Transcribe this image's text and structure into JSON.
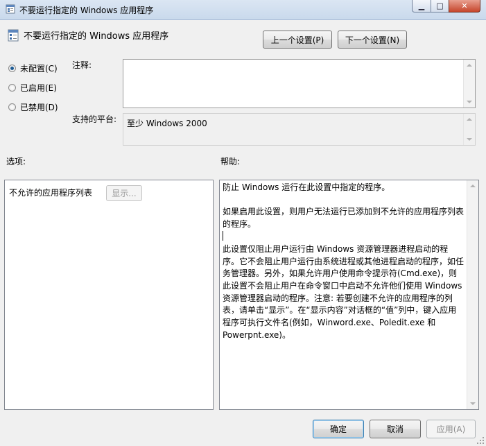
{
  "window": {
    "title": "不要运行指定的 Windows 应用程序",
    "min_glyph": "▁",
    "max_glyph": "□",
    "close_glyph": "✕"
  },
  "header": {
    "title": "不要运行指定的 Windows 应用程序",
    "prev_label": "上一个设置(P)",
    "next_label": "下一个设置(N)"
  },
  "state": {
    "options": [
      {
        "label": "未配置(C)",
        "selected": true
      },
      {
        "label": "已启用(E)",
        "selected": false
      },
      {
        "label": "已禁用(D)",
        "selected": false
      }
    ]
  },
  "comment": {
    "label": "注释:",
    "value": ""
  },
  "platform": {
    "label": "支持的平台:",
    "value": "至少 Windows 2000"
  },
  "options_panel": {
    "heading": "选项:",
    "item_label": "不允许的应用程序列表",
    "show_label": "显示..."
  },
  "help": {
    "heading": "帮助:",
    "para1": "防止 Windows 运行在此设置中指定的程序。",
    "para2": "如果启用此设置，则用户无法运行已添加到不允许的应用程序列表的程序。",
    "para3": "此设置仅阻止用户运行由 Windows 资源管理器进程启动的程序。它不会阻止用户运行由系统进程或其他进程启动的程序，如任务管理器。另外，如果允许用户使用命令提示符(Cmd.exe)，则此设置不会阻止用户在命令窗口中启动不允许他们使用 Windows 资源管理器启动的程序。注意: 若要创建不允许的应用程序的列表，请单击“显示”。在“显示内容”对话框的“值”列中，键入应用程序可执行文件名(例如，Winword.exe、Poledit.exe 和 Powerpnt.exe)。"
  },
  "footer": {
    "ok_label": "确定",
    "cancel_label": "取消",
    "apply_label": "应用(A)"
  },
  "colors": {
    "titlebar": "#c9d9ec",
    "close": "#c6452b",
    "radio_selected": "#1c5a93"
  }
}
